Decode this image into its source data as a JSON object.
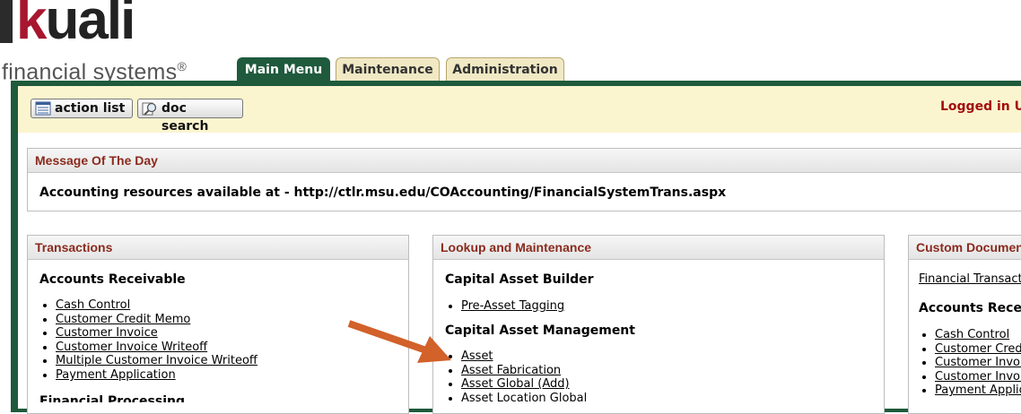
{
  "logo": {
    "word_first": "k",
    "word_rest": "uali",
    "subtitle": "financial systems",
    "reg_mark": "®"
  },
  "tabs": [
    {
      "label": "Main Menu",
      "active": true
    },
    {
      "label": "Maintenance",
      "active": false
    },
    {
      "label": "Administration",
      "active": false
    }
  ],
  "toolbar": {
    "action_list_label": "action list",
    "action_list_icon": "list-icon",
    "doc_search_label": "doc search",
    "doc_search_icon": "magnifier-icon",
    "logged_in_text": "Logged in U"
  },
  "message_of_the_day": {
    "title": "Message Of The Day",
    "text": "Accounting resources available at - http://ctlr.msu.edu/COAccounting/FinancialSystemTrans.aspx"
  },
  "transactions": {
    "title": "Transactions",
    "section": "Accounts Receivable",
    "links": [
      "Cash Control",
      "Customer Credit Memo",
      "Customer Invoice",
      "Customer Invoice Writeoff",
      "Multiple Customer Invoice Writeoff",
      "Payment Application"
    ],
    "next_section": "Financial Processing"
  },
  "lookup": {
    "title": "Lookup and Maintenance",
    "section1": "Capital Asset Builder",
    "section1_links": [
      "Pre-Asset Tagging"
    ],
    "section2": "Capital Asset Management",
    "section2_links": [
      "Asset",
      "Asset Fabrication",
      "Asset Global (Add)",
      "Asset Location Global"
    ]
  },
  "custom": {
    "title": "Custom Documents",
    "link": "Financial Transactions",
    "section": "Accounts Receivable",
    "links": [
      "Cash Control",
      "Customer Credit Memo",
      "Customer Invoice",
      "Customer Invoice Writeoff",
      "Payment Application"
    ]
  },
  "annotation": {
    "arrow_color": "#d2612a",
    "arrow_icon": "arrow-icon"
  },
  "colors": {
    "frame_green": "#1f5a3c",
    "tab_beige": "#f0e9c4",
    "toolbar_yellow": "#fbf5cf",
    "header_red": "#8a2a1d",
    "brand_red": "#a7162e"
  }
}
